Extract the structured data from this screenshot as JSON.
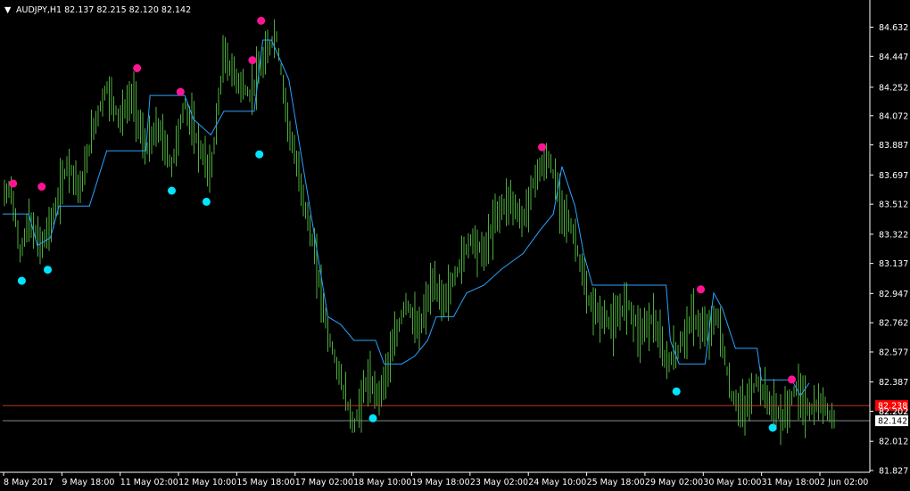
{
  "header": {
    "menu_glyph": "▼",
    "title": "AUDJPY,H1  82.137 82.215 82.120 82.142"
  },
  "colors": {
    "background": "#000000",
    "axis": "#ffffff",
    "candle": "#4caf3a",
    "trail_line": "#2aa3ff",
    "high_dot": "#ff1493",
    "low_dot": "#00e5ff",
    "bid_line": "#c0392b",
    "ask_line": "#7f8c8d",
    "bid_tag": "#ff0000"
  },
  "price_tags": {
    "bid": "82.238",
    "last": "82.202",
    "current": "82.142"
  },
  "chart_data": {
    "type": "line",
    "symbol": "AUDJPY",
    "timeframe": "H1",
    "ohlc_last": {
      "open": 82.137,
      "high": 82.215,
      "low": 82.12,
      "close": 82.142
    },
    "ylim": [
      81.827,
      84.725
    ],
    "y_ticks": [
      "84.632",
      "84.447",
      "84.252",
      "84.072",
      "83.887",
      "83.697",
      "83.512",
      "83.322",
      "83.137",
      "82.947",
      "82.762",
      "82.577",
      "82.387",
      "82.202",
      "82.012",
      "81.827"
    ],
    "x_ticks": [
      "8 May 2017",
      "9 May 18:00",
      "11 May 02:00",
      "12 May 10:00",
      "15 May 18:00",
      "17 May 02:00",
      "18 May 10:00",
      "19 May 18:00",
      "23 May 02:00",
      "24 May 10:00",
      "25 May 18:00",
      "29 May 02:00",
      "30 May 10:00",
      "31 May 18:00",
      "2 Jun 02:00"
    ],
    "price_series": [
      [
        0,
        83.55
      ],
      [
        0.01,
        83.62
      ],
      [
        0.02,
        83.2
      ],
      [
        0.03,
        83.4
      ],
      [
        0.045,
        83.25
      ],
      [
        0.06,
        83.45
      ],
      [
        0.075,
        83.78
      ],
      [
        0.09,
        83.6
      ],
      [
        0.105,
        84.0
      ],
      [
        0.12,
        84.25
      ],
      [
        0.135,
        84.05
      ],
      [
        0.15,
        84.2
      ],
      [
        0.165,
        83.85
      ],
      [
        0.18,
        84.0
      ],
      [
        0.195,
        83.75
      ],
      [
        0.21,
        84.15
      ],
      [
        0.225,
        83.9
      ],
      [
        0.24,
        83.7
      ],
      [
        0.255,
        84.45
      ],
      [
        0.27,
        84.3
      ],
      [
        0.285,
        84.2
      ],
      [
        0.3,
        84.4
      ],
      [
        0.315,
        84.6
      ],
      [
        0.33,
        84.0
      ],
      [
        0.345,
        83.6
      ],
      [
        0.36,
        83.2
      ],
      [
        0.375,
        82.7
      ],
      [
        0.39,
        82.4
      ],
      [
        0.405,
        82.1
      ],
      [
        0.42,
        82.4
      ],
      [
        0.435,
        82.3
      ],
      [
        0.45,
        82.6
      ],
      [
        0.465,
        82.9
      ],
      [
        0.48,
        82.7
      ],
      [
        0.495,
        83.0
      ],
      [
        0.51,
        82.9
      ],
      [
        0.525,
        83.1
      ],
      [
        0.54,
        83.3
      ],
      [
        0.555,
        83.2
      ],
      [
        0.57,
        83.45
      ],
      [
        0.585,
        83.55
      ],
      [
        0.6,
        83.4
      ],
      [
        0.615,
        83.7
      ],
      [
        0.63,
        83.8
      ],
      [
        0.645,
        83.5
      ],
      [
        0.66,
        83.3
      ],
      [
        0.675,
        82.9
      ],
      [
        0.69,
        82.8
      ],
      [
        0.705,
        82.75
      ],
      [
        0.72,
        82.9
      ],
      [
        0.735,
        82.7
      ],
      [
        0.75,
        82.8
      ],
      [
        0.765,
        82.5
      ],
      [
        0.78,
        82.6
      ],
      [
        0.795,
        82.8
      ],
      [
        0.81,
        82.7
      ],
      [
        0.825,
        82.8
      ],
      [
        0.84,
        82.3
      ],
      [
        0.855,
        82.2
      ],
      [
        0.87,
        82.4
      ],
      [
        0.885,
        82.25
      ],
      [
        0.9,
        82.15
      ],
      [
        0.915,
        82.35
      ],
      [
        0.93,
        82.2
      ],
      [
        0.945,
        82.25
      ],
      [
        0.96,
        82.14
      ]
    ],
    "trail_series": [
      [
        0,
        83.45
      ],
      [
        0.03,
        83.45
      ],
      [
        0.04,
        83.25
      ],
      [
        0.055,
        83.3
      ],
      [
        0.065,
        83.5
      ],
      [
        0.1,
        83.5
      ],
      [
        0.12,
        83.85
      ],
      [
        0.165,
        83.85
      ],
      [
        0.17,
        84.2
      ],
      [
        0.21,
        84.2
      ],
      [
        0.22,
        84.05
      ],
      [
        0.24,
        83.95
      ],
      [
        0.255,
        84.1
      ],
      [
        0.29,
        84.1
      ],
      [
        0.3,
        84.55
      ],
      [
        0.31,
        84.55
      ],
      [
        0.33,
        84.3
      ],
      [
        0.345,
        83.8
      ],
      [
        0.36,
        83.3
      ],
      [
        0.375,
        82.8
      ],
      [
        0.39,
        82.75
      ],
      [
        0.405,
        82.65
      ],
      [
        0.43,
        82.65
      ],
      [
        0.44,
        82.5
      ],
      [
        0.46,
        82.5
      ],
      [
        0.475,
        82.55
      ],
      [
        0.49,
        82.65
      ],
      [
        0.5,
        82.8
      ],
      [
        0.52,
        82.8
      ],
      [
        0.535,
        82.95
      ],
      [
        0.555,
        83.0
      ],
      [
        0.575,
        83.1
      ],
      [
        0.6,
        83.2
      ],
      [
        0.62,
        83.35
      ],
      [
        0.635,
        83.45
      ],
      [
        0.645,
        83.75
      ],
      [
        0.66,
        83.5
      ],
      [
        0.67,
        83.2
      ],
      [
        0.68,
        83.0
      ],
      [
        0.765,
        83.0
      ],
      [
        0.77,
        82.65
      ],
      [
        0.78,
        82.5
      ],
      [
        0.81,
        82.5
      ],
      [
        0.82,
        82.95
      ],
      [
        0.83,
        82.85
      ],
      [
        0.845,
        82.6
      ],
      [
        0.87,
        82.6
      ],
      [
        0.875,
        82.4
      ],
      [
        0.91,
        82.4
      ],
      [
        0.92,
        82.3
      ],
      [
        0.93,
        82.38
      ]
    ],
    "high_markers": [
      [
        0.012,
        83.62
      ],
      [
        0.045,
        83.6
      ],
      [
        0.155,
        84.35
      ],
      [
        0.205,
        84.2
      ],
      [
        0.288,
        84.4
      ],
      [
        0.298,
        84.65
      ],
      [
        0.622,
        83.85
      ],
      [
        0.805,
        82.95
      ],
      [
        0.91,
        82.38
      ]
    ],
    "low_markers": [
      [
        0.022,
        83.05
      ],
      [
        0.052,
        83.12
      ],
      [
        0.195,
        83.62
      ],
      [
        0.235,
        83.55
      ],
      [
        0.296,
        83.85
      ],
      [
        0.427,
        82.18
      ],
      [
        0.777,
        82.35
      ],
      [
        0.888,
        82.12
      ]
    ],
    "bid_level": 82.238,
    "ask_level": 82.142,
    "grid": false
  }
}
